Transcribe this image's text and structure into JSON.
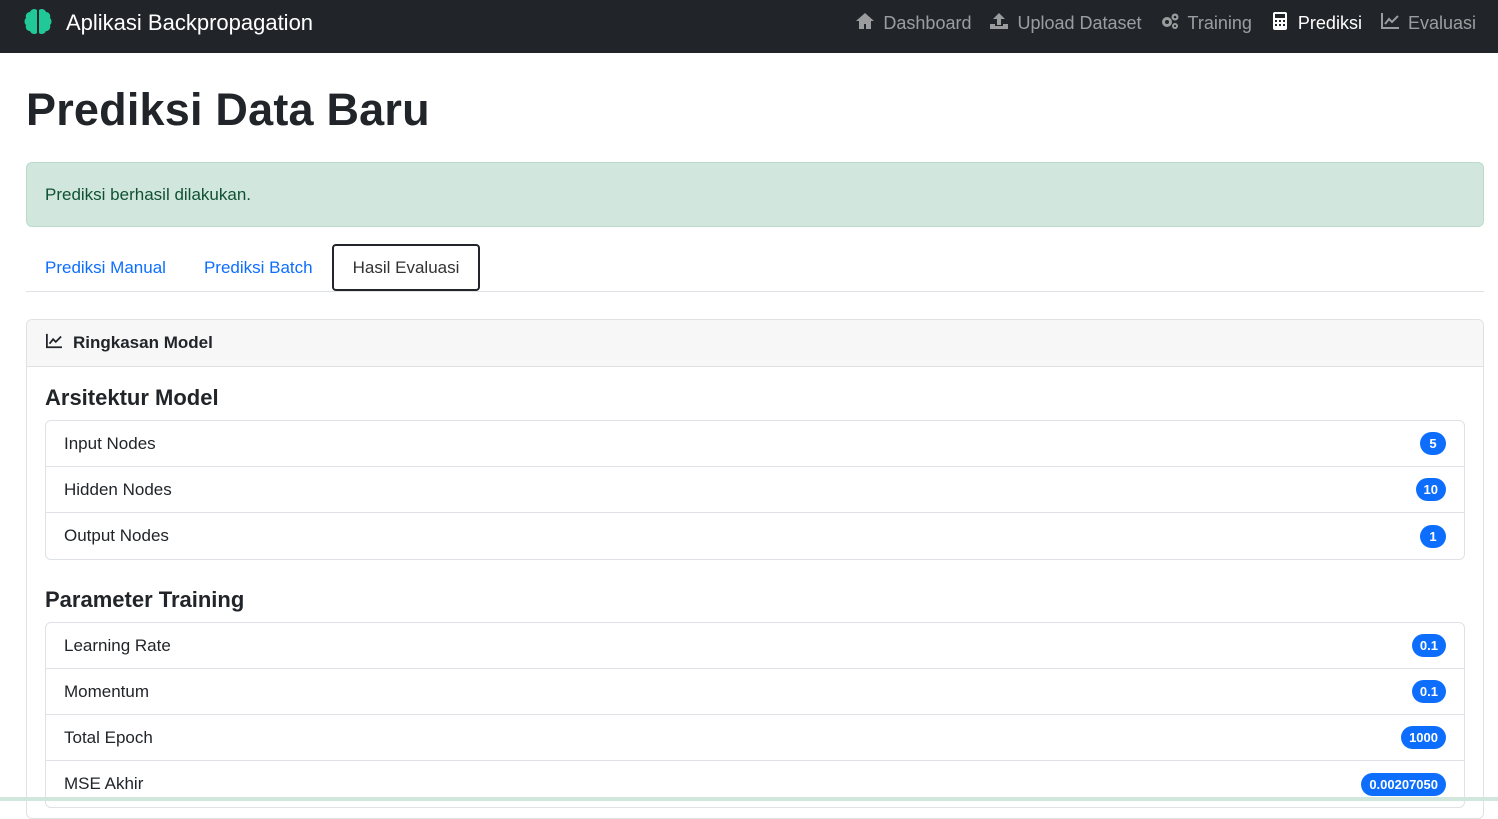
{
  "navbar": {
    "brand": "Aplikasi Backpropagation",
    "links": [
      {
        "label": "Dashboard",
        "icon": "home-icon"
      },
      {
        "label": "Upload Dataset",
        "icon": "upload-icon"
      },
      {
        "label": "Training",
        "icon": "gears-icon"
      },
      {
        "label": "Prediksi",
        "icon": "calculator-icon",
        "active": true
      },
      {
        "label": "Evaluasi",
        "icon": "chart-line-icon"
      }
    ]
  },
  "page": {
    "title": "Prediksi Data Baru",
    "alert": "Prediksi berhasil dilakukan."
  },
  "tabs": [
    {
      "label": "Prediksi Manual"
    },
    {
      "label": "Prediksi Batch"
    },
    {
      "label": "Hasil Evaluasi",
      "active": true
    }
  ],
  "card": {
    "header": "Ringkasan Model",
    "architecture": {
      "title": "Arsitektur Model",
      "items": [
        {
          "label": "Input Nodes",
          "value": "5"
        },
        {
          "label": "Hidden Nodes",
          "value": "10"
        },
        {
          "label": "Output Nodes",
          "value": "1"
        }
      ]
    },
    "training": {
      "title": "Parameter Training",
      "items": [
        {
          "label": "Learning Rate",
          "value": "0.1"
        },
        {
          "label": "Momentum",
          "value": "0.1"
        },
        {
          "label": "Total Epoch",
          "value": "1000"
        },
        {
          "label": "MSE Akhir",
          "value": "0.00207050"
        }
      ]
    }
  },
  "colors": {
    "navbar_bg": "#212529",
    "brand_icon": "#20c997",
    "accent": "#0d6efd",
    "alert_bg": "#d1e7dd",
    "alert_text": "#0f5132"
  }
}
